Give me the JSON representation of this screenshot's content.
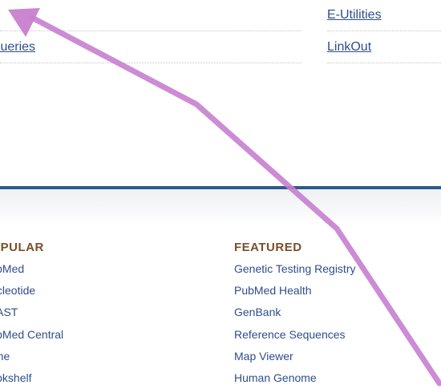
{
  "top_links": {
    "left": [
      {
        "label": ""
      },
      {
        "label": "Queries"
      }
    ],
    "right": [
      {
        "label": "E-Utilities"
      },
      {
        "label": "LinkOut"
      }
    ]
  },
  "footer": {
    "popular": {
      "heading": "POPULAR",
      "items": [
        "PubMed",
        "Nucleotide",
        "BLAST",
        "PubMed Central",
        "Gene",
        "Bookshelf"
      ]
    },
    "featured": {
      "heading": "FEATURED",
      "items": [
        "Genetic Testing Registry",
        "PubMed Health",
        "GenBank",
        "Reference Sequences",
        "Map Viewer",
        "Human Genome"
      ]
    }
  },
  "overlay": {
    "icon": "arrow-annotation-icon",
    "color": "#c77fcf"
  }
}
